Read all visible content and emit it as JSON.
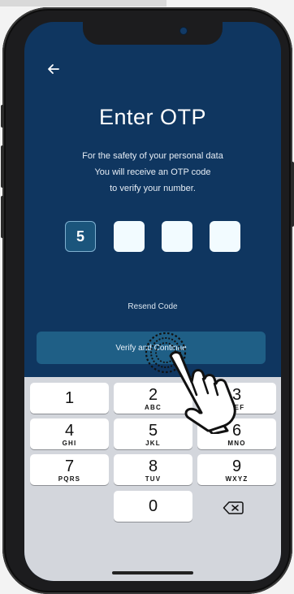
{
  "screen": {
    "title": "Enter OTP",
    "description_lines": [
      "For the safety of your personal data",
      "You will receive an OTP code",
      "to verify your number."
    ],
    "otp_digits": [
      "5",
      "",
      "",
      ""
    ],
    "resend_label": "Resend Code",
    "verify_label": "Verify and Continue",
    "back_icon": "arrow-left-icon"
  },
  "keyboard": {
    "keys": [
      {
        "num": "1",
        "letters": ""
      },
      {
        "num": "2",
        "letters": "ABC"
      },
      {
        "num": "3",
        "letters": "DEF"
      },
      {
        "num": "4",
        "letters": "GHI"
      },
      {
        "num": "5",
        "letters": "JKL"
      },
      {
        "num": "6",
        "letters": "MNO"
      },
      {
        "num": "7",
        "letters": "PQRS"
      },
      {
        "num": "8",
        "letters": "TUV"
      },
      {
        "num": "9",
        "letters": "WXYZ"
      },
      {
        "num": "0",
        "letters": ""
      }
    ],
    "delete_icon": "backspace-icon"
  },
  "colors": {
    "background": "#0f3660",
    "button": "#1f5f86",
    "otp_filled": "#1b557c",
    "otp_empty": "#f2fbff",
    "keyboard": "#d3d6dc"
  }
}
